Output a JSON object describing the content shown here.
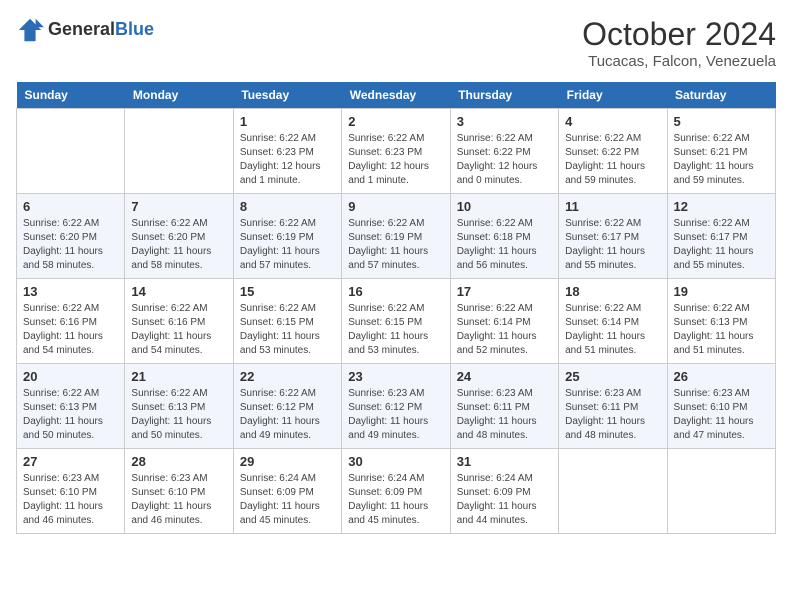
{
  "header": {
    "logo_general": "General",
    "logo_blue": "Blue",
    "title": "October 2024",
    "subtitle": "Tucacas, Falcon, Venezuela"
  },
  "calendar": {
    "days_of_week": [
      "Sunday",
      "Monday",
      "Tuesday",
      "Wednesday",
      "Thursday",
      "Friday",
      "Saturday"
    ],
    "weeks": [
      [
        {
          "day": "",
          "info": ""
        },
        {
          "day": "",
          "info": ""
        },
        {
          "day": "1",
          "info": "Sunrise: 6:22 AM\nSunset: 6:23 PM\nDaylight: 12 hours and 1 minute."
        },
        {
          "day": "2",
          "info": "Sunrise: 6:22 AM\nSunset: 6:23 PM\nDaylight: 12 hours and 1 minute."
        },
        {
          "day": "3",
          "info": "Sunrise: 6:22 AM\nSunset: 6:22 PM\nDaylight: 12 hours and 0 minutes."
        },
        {
          "day": "4",
          "info": "Sunrise: 6:22 AM\nSunset: 6:22 PM\nDaylight: 11 hours and 59 minutes."
        },
        {
          "day": "5",
          "info": "Sunrise: 6:22 AM\nSunset: 6:21 PM\nDaylight: 11 hours and 59 minutes."
        }
      ],
      [
        {
          "day": "6",
          "info": "Sunrise: 6:22 AM\nSunset: 6:20 PM\nDaylight: 11 hours and 58 minutes."
        },
        {
          "day": "7",
          "info": "Sunrise: 6:22 AM\nSunset: 6:20 PM\nDaylight: 11 hours and 58 minutes."
        },
        {
          "day": "8",
          "info": "Sunrise: 6:22 AM\nSunset: 6:19 PM\nDaylight: 11 hours and 57 minutes."
        },
        {
          "day": "9",
          "info": "Sunrise: 6:22 AM\nSunset: 6:19 PM\nDaylight: 11 hours and 57 minutes."
        },
        {
          "day": "10",
          "info": "Sunrise: 6:22 AM\nSunset: 6:18 PM\nDaylight: 11 hours and 56 minutes."
        },
        {
          "day": "11",
          "info": "Sunrise: 6:22 AM\nSunset: 6:17 PM\nDaylight: 11 hours and 55 minutes."
        },
        {
          "day": "12",
          "info": "Sunrise: 6:22 AM\nSunset: 6:17 PM\nDaylight: 11 hours and 55 minutes."
        }
      ],
      [
        {
          "day": "13",
          "info": "Sunrise: 6:22 AM\nSunset: 6:16 PM\nDaylight: 11 hours and 54 minutes."
        },
        {
          "day": "14",
          "info": "Sunrise: 6:22 AM\nSunset: 6:16 PM\nDaylight: 11 hours and 54 minutes."
        },
        {
          "day": "15",
          "info": "Sunrise: 6:22 AM\nSunset: 6:15 PM\nDaylight: 11 hours and 53 minutes."
        },
        {
          "day": "16",
          "info": "Sunrise: 6:22 AM\nSunset: 6:15 PM\nDaylight: 11 hours and 53 minutes."
        },
        {
          "day": "17",
          "info": "Sunrise: 6:22 AM\nSunset: 6:14 PM\nDaylight: 11 hours and 52 minutes."
        },
        {
          "day": "18",
          "info": "Sunrise: 6:22 AM\nSunset: 6:14 PM\nDaylight: 11 hours and 51 minutes."
        },
        {
          "day": "19",
          "info": "Sunrise: 6:22 AM\nSunset: 6:13 PM\nDaylight: 11 hours and 51 minutes."
        }
      ],
      [
        {
          "day": "20",
          "info": "Sunrise: 6:22 AM\nSunset: 6:13 PM\nDaylight: 11 hours and 50 minutes."
        },
        {
          "day": "21",
          "info": "Sunrise: 6:22 AM\nSunset: 6:13 PM\nDaylight: 11 hours and 50 minutes."
        },
        {
          "day": "22",
          "info": "Sunrise: 6:22 AM\nSunset: 6:12 PM\nDaylight: 11 hours and 49 minutes."
        },
        {
          "day": "23",
          "info": "Sunrise: 6:23 AM\nSunset: 6:12 PM\nDaylight: 11 hours and 49 minutes."
        },
        {
          "day": "24",
          "info": "Sunrise: 6:23 AM\nSunset: 6:11 PM\nDaylight: 11 hours and 48 minutes."
        },
        {
          "day": "25",
          "info": "Sunrise: 6:23 AM\nSunset: 6:11 PM\nDaylight: 11 hours and 48 minutes."
        },
        {
          "day": "26",
          "info": "Sunrise: 6:23 AM\nSunset: 6:10 PM\nDaylight: 11 hours and 47 minutes."
        }
      ],
      [
        {
          "day": "27",
          "info": "Sunrise: 6:23 AM\nSunset: 6:10 PM\nDaylight: 11 hours and 46 minutes."
        },
        {
          "day": "28",
          "info": "Sunrise: 6:23 AM\nSunset: 6:10 PM\nDaylight: 11 hours and 46 minutes."
        },
        {
          "day": "29",
          "info": "Sunrise: 6:24 AM\nSunset: 6:09 PM\nDaylight: 11 hours and 45 minutes."
        },
        {
          "day": "30",
          "info": "Sunrise: 6:24 AM\nSunset: 6:09 PM\nDaylight: 11 hours and 45 minutes."
        },
        {
          "day": "31",
          "info": "Sunrise: 6:24 AM\nSunset: 6:09 PM\nDaylight: 11 hours and 44 minutes."
        },
        {
          "day": "",
          "info": ""
        },
        {
          "day": "",
          "info": ""
        }
      ]
    ]
  }
}
